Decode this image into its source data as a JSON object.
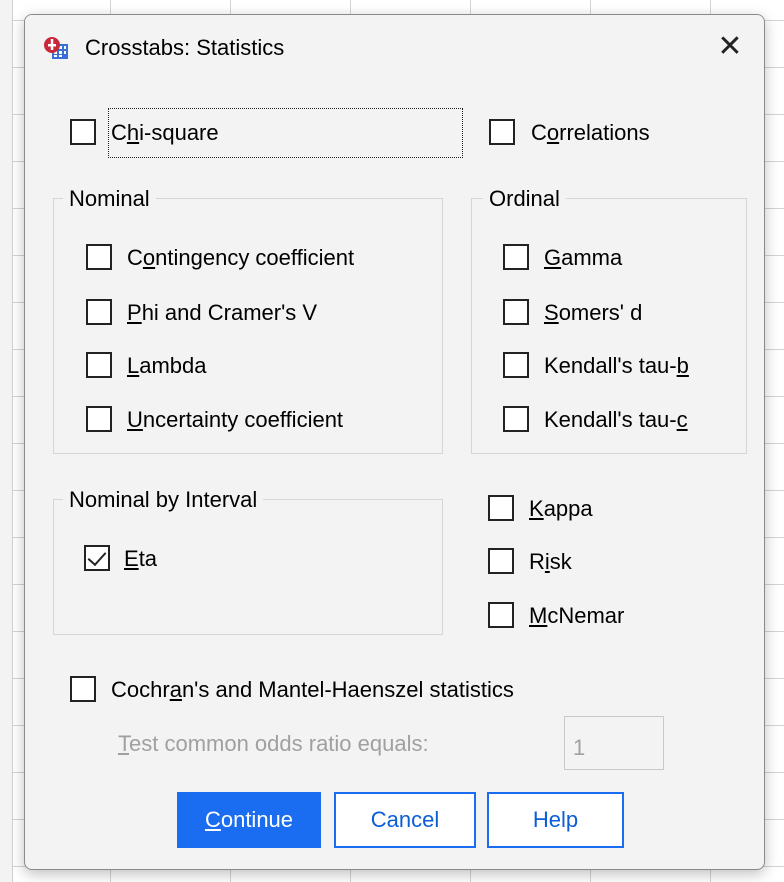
{
  "window": {
    "title": "Crosstabs: Statistics",
    "close_glyph": "✕",
    "app_icon": "spss-crosstabs-icon"
  },
  "top": {
    "chi_square": {
      "label": "Chi-square",
      "checked": false
    },
    "correlations": {
      "label": "Correlations",
      "checked": false
    }
  },
  "nominal": {
    "title": "Nominal",
    "items": [
      {
        "label": "Contingency coefficient",
        "checked": false
      },
      {
        "label": "Phi and Cramer's V",
        "checked": false
      },
      {
        "label": "Lambda",
        "checked": false
      },
      {
        "label": "Uncertainty coefficient",
        "checked": false
      }
    ]
  },
  "ordinal": {
    "title": "Ordinal",
    "items": [
      {
        "label": "Gamma",
        "checked": false
      },
      {
        "label": "Somers' d",
        "checked": false
      },
      {
        "label": "Kendall's tau-b",
        "checked": false
      },
      {
        "label": "Kendall's tau-c",
        "checked": false
      }
    ]
  },
  "nominal_by_interval": {
    "title": "Nominal by Interval",
    "items": [
      {
        "label": "Eta",
        "checked": true
      }
    ]
  },
  "other": {
    "items": [
      {
        "label": "Kappa",
        "checked": false
      },
      {
        "label": "Risk",
        "checked": false
      },
      {
        "label": "McNemar",
        "checked": false
      }
    ]
  },
  "cochran": {
    "label": "Cochran's and Mantel-Haenszel statistics",
    "checked": false,
    "odds_label": "Test common odds ratio equals:",
    "odds_value": "1"
  },
  "buttons": {
    "continue": "Continue",
    "cancel": "Cancel",
    "help": "Help"
  },
  "colors": {
    "accent": "#1a6cf0",
    "dialog_bg": "#f3f3f3",
    "disabled_text": "#a0a0a0"
  }
}
